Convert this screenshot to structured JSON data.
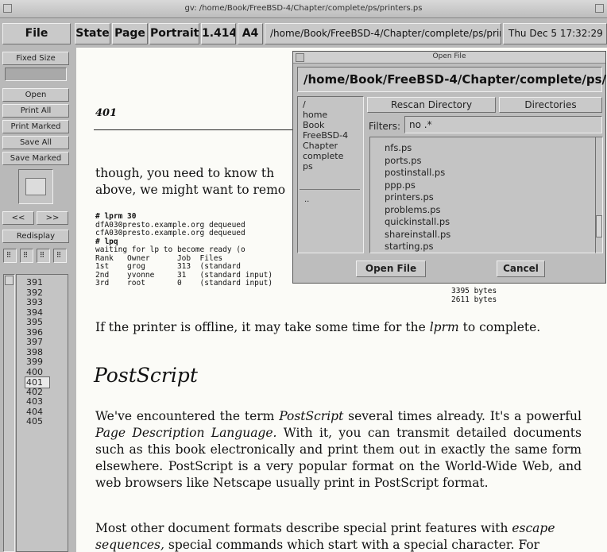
{
  "window": {
    "title": "gv: /home/Book/FreeBSD-4/Chapter/complete/ps/printers.ps"
  },
  "menubar": {
    "file": "File",
    "state": "State",
    "page": "Page",
    "orientation": "Portrait",
    "scale": "1.414",
    "paper": "A4",
    "path": "/home/Book/FreeBSD-4/Chapter/complete/ps/prin",
    "datetime": "Thu Dec  5 17:32:29 20"
  },
  "sidebar": {
    "fixed_size": "Fixed Size",
    "open": "Open",
    "print_all": "Print All",
    "print_marked": "Print Marked",
    "save_all": "Save All",
    "save_marked": "Save Marked",
    "prev": "<<",
    "next": ">>",
    "redisplay": "Redisplay",
    "pages": [
      "391",
      "392",
      "393",
      "394",
      "395",
      "396",
      "397",
      "398",
      "399",
      "400",
      "401",
      "402",
      "403",
      "404",
      "405"
    ],
    "selected_page": "401"
  },
  "document": {
    "page_number": "401",
    "para1_line1": "though, you need to know th",
    "para1_line2": "above, we might want to remo",
    "code_lines": [
      "# lprm 30",
      "dfA030presto.example.org dequeued",
      "cfA030presto.example.org dequeued",
      "# lpq",
      "waiting for lp to become ready (o",
      "Rank   Owner      Job  Files",
      "1st    grog       313  (standard",
      "2nd    yvonne     31   (standard input)",
      "3rd    root       0    (standard input)"
    ],
    "code_bytes": [
      "3395 bytes",
      "2611 bytes"
    ],
    "offline_sentence_pre": "If the printer is offline, it may take some time for the ",
    "offline_sentence_em": "lprm",
    "offline_sentence_post": " to complete.",
    "heading": "PostScript",
    "para2": [
      {
        "t": "We've encountered the term "
      },
      {
        "t": "PostScript",
        "em": true
      },
      {
        "t": " several times already. It's a powerful "
      },
      {
        "t": "Page Description Language.",
        "em": true
      },
      {
        "t": " With it, you can transmit detailed documents such as this book electronically and print them out in exactly the same form elsewhere. PostScript is a very popular format on the World-Wide Web, and web browsers like Netscape usually print in PostScript format."
      }
    ],
    "para3_line1_pre": "Most other document formats describe special print features with ",
    "para3_line1_em": "escape",
    "para3_line2_em": "sequences,",
    "para3_line2_post": " special commands which start with a special character. For"
  },
  "open_file_dialog": {
    "title": "Open File",
    "path": "/home/Book/FreeBSD-4/Chapter/complete/ps/",
    "dirs": [
      "/",
      "home",
      "Book",
      "FreeBSD-4",
      "Chapter",
      "complete",
      "ps"
    ],
    "parent_dir": "..",
    "rescan": "Rescan Directory",
    "directories": "Directories",
    "filters_label": "Filters:",
    "filters_value": "no .*",
    "files": [
      "nfs.ps",
      "ports.ps",
      "postinstall.ps",
      "ppp.ps",
      "printers.ps",
      "problems.ps",
      "quickinstall.ps",
      "shareinstall.ps",
      "starting.ps"
    ],
    "open_button": "Open File",
    "cancel_button": "Cancel"
  }
}
